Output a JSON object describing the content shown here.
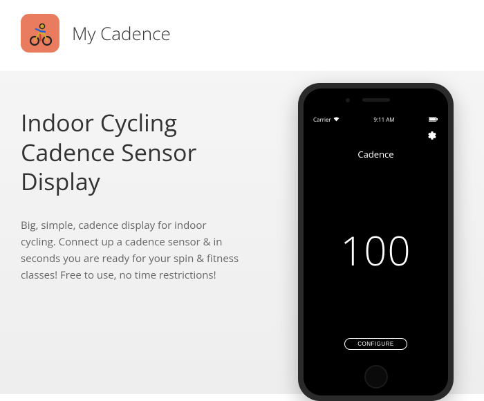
{
  "header": {
    "app_title": "My Cadence"
  },
  "content": {
    "headline": "Indoor Cycling Cadence Sensor Display",
    "description": "Big, simple, cadence display for indoor cycling. Connect up a cadence sensor & in seconds you are ready for your spin & fitness classes! Free to use, no time restrictions!"
  },
  "phone": {
    "status": {
      "carrier": "Carrier",
      "time": "9:11 AM"
    },
    "screen": {
      "title": "Cadence",
      "value": "100",
      "configure_label": "CONFIGURE"
    }
  }
}
